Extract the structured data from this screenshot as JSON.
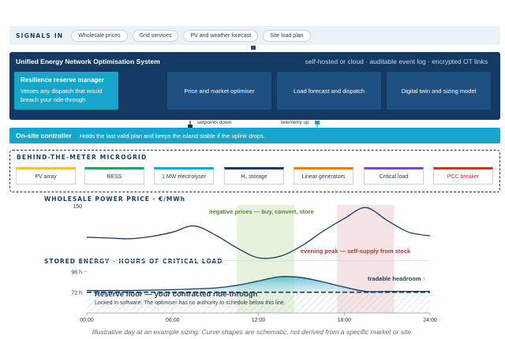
{
  "signals": {
    "label": "SIGNALS IN",
    "items": [
      "Wholesale prices",
      "Grid services",
      "PV and weather forecast",
      "Site load plan"
    ]
  },
  "system": {
    "title": "Unified Energy Network Optimisation System",
    "subtitle": "self-hosted or cloud · auditable event log · encrypted OT links",
    "modules": [
      {
        "title": "Resilience reserve manager",
        "desc": "Vetoes any dispatch that would breach your ride-through"
      },
      {
        "title": "Price and market optimiser"
      },
      {
        "title": "Load forecast and dispatch"
      },
      {
        "title": "Digital twin and sizing model"
      }
    ]
  },
  "links": {
    "down": "setpoints down",
    "up": "telemetry up"
  },
  "controller": {
    "title": "On-site controller",
    "desc": "Holds the last valid plan and keeps the island stable if the uplink drops."
  },
  "microgrid": {
    "label": "BEHIND-THE-METER MICROGRID",
    "assets": [
      {
        "name": "PV array",
        "color": "#f2c335"
      },
      {
        "name": "BESS",
        "color": "#2e9e5b"
      },
      {
        "name": "1 MW electrolyser",
        "color": "#17a6c9"
      },
      {
        "name": "H₂ storage",
        "color": "#1b3a5c"
      },
      {
        "name": "Linear generators",
        "color": "#e67e22"
      },
      {
        "name": "Critical load",
        "color": "#7b4fb3"
      },
      {
        "name": "PCC breaker",
        "color": "#c0392b"
      }
    ]
  },
  "price_chart": {
    "title": "WHOLESALE POWER PRICE · €/MWh",
    "negative_note": "negative prices — buy, convert, store",
    "peak_note": "evening peak — self-supply from stock"
  },
  "energy_chart": {
    "title": "STORED ENERGY · HOURS OF CRITICAL LOAD",
    "headroom_label": "tradable headroom ↑",
    "reserve_title": "Reserve floor — your contracted ride-through",
    "reserve_desc": "Locked in software. The optimiser has no authority to schedule below this line."
  },
  "chart_data": [
    {
      "type": "line",
      "title": "WHOLESALE POWER PRICE · €/MWh",
      "x": [
        0,
        1.5,
        3,
        4.5,
        6,
        7.5,
        9,
        10.5,
        12,
        13.5,
        15,
        16.5,
        18,
        19.5,
        21,
        22.5,
        24
      ],
      "y": [
        64,
        62,
        60,
        66,
        78,
        95,
        70,
        35,
        8,
        12,
        40,
        80,
        115,
        145,
        110,
        78,
        68
      ],
      "yticks": [
        0,
        150
      ],
      "ylim": [
        -20,
        165
      ],
      "xlim": [
        0,
        24
      ],
      "bands": [
        {
          "label": "negative prices — buy, convert, store",
          "from": 10.5,
          "to": 14.5,
          "color": "#e5f2dc"
        },
        {
          "label": "evening peak — self-supply from stock",
          "from": 17.5,
          "to": 21.5,
          "color": "#f6e3e3"
        }
      ]
    },
    {
      "type": "area",
      "title": "STORED ENERGY · HOURS OF CRITICAL LOAD",
      "x": [
        0,
        3,
        6,
        9,
        10.5,
        12,
        13.5,
        15,
        16.5,
        18,
        19.5,
        21,
        24
      ],
      "y": [
        74,
        74,
        75,
        77,
        80,
        85,
        90,
        89,
        84,
        78,
        73,
        73,
        73
      ],
      "yticks": [
        72,
        96
      ],
      "ytick_labels": [
        "72 h",
        "96 h"
      ],
      "xticks": [
        "00:00",
        "06:00",
        "12:00",
        "18:00",
        "24:00"
      ],
      "ylim": [
        48,
        100
      ],
      "xlim": [
        0,
        24
      ],
      "reserve_floor": 72
    }
  ]
}
